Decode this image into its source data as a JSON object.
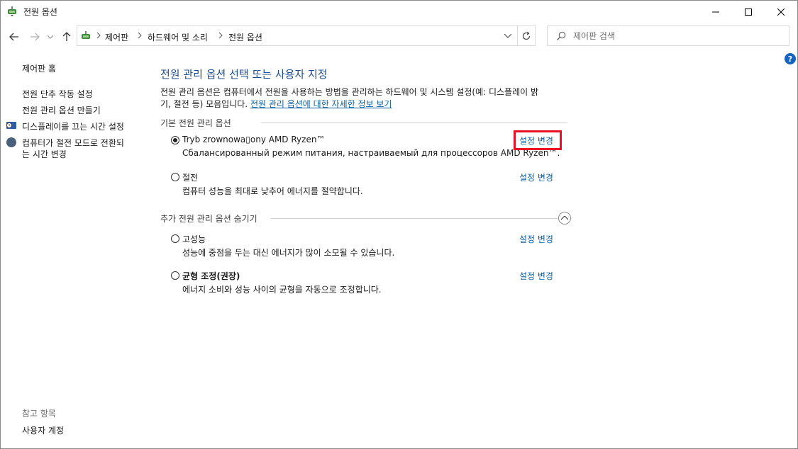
{
  "window": {
    "title": "전원 옵션",
    "app_icon": "power-options-icon"
  },
  "nav": {
    "breadcrumbs": [
      "제어판",
      "하드웨어 및 소리",
      "전원 옵션"
    ],
    "search_placeholder": "제어판 검색"
  },
  "sidebar": {
    "home": "제어판 홈",
    "links": [
      "전원 단추 작동 설정",
      "전원 관리 옵션 만들기",
      "디스플레이를 끄는 시간 설정",
      "컴퓨터가 절전 모드로 전환되",
      "는 시간 변경"
    ],
    "see_also_label": "참고 항목",
    "see_also_links": [
      "사용자 계정"
    ]
  },
  "main": {
    "heading": "전원 관리 옵션 선택 또는 사용자 지정",
    "description_line1": "전원 관리 옵션은 컴퓨터에서 전원을 사용하는 방법을 관리하는 하드웨어 및 시스템 설정(예: 디스플레이 밝",
    "description_line2": "기, 절전 등) 모음입니다. ",
    "description_link": "전원 관리 옵션에 대한 자세한 정보 보기",
    "preferred_section": "기본 전원 관리 옵션",
    "additional_section": "추가 전원 관리 옵션 숨기기",
    "change_label": "설정 변경",
    "plans": [
      {
        "name": "Tryb zrownowa▯ony AMD Ryzen™",
        "description": "Сбалансированный режим питания, настраиваемый для процессоров AMD Ryzen™.",
        "selected": true,
        "bold": false
      },
      {
        "name": "절전",
        "description": "컴퓨터 성능을 최대로 낮추어 에너지를 절약합니다.",
        "selected": false,
        "bold": false
      },
      {
        "name": "고성능",
        "description": "성능에 중점을 두는 대신 에너지가 많이 소모될 수 있습니다.",
        "selected": false,
        "bold": false
      },
      {
        "name": "균형 조정(권장)",
        "description": "에너지 소비와 성능 사이의 균형을 자동으로 조정합니다.",
        "selected": false,
        "bold": true
      }
    ]
  },
  "colors": {
    "heading": "#1e4e8c",
    "link": "#0b61a4",
    "highlight": "#e81123",
    "help": "#1565c0"
  }
}
